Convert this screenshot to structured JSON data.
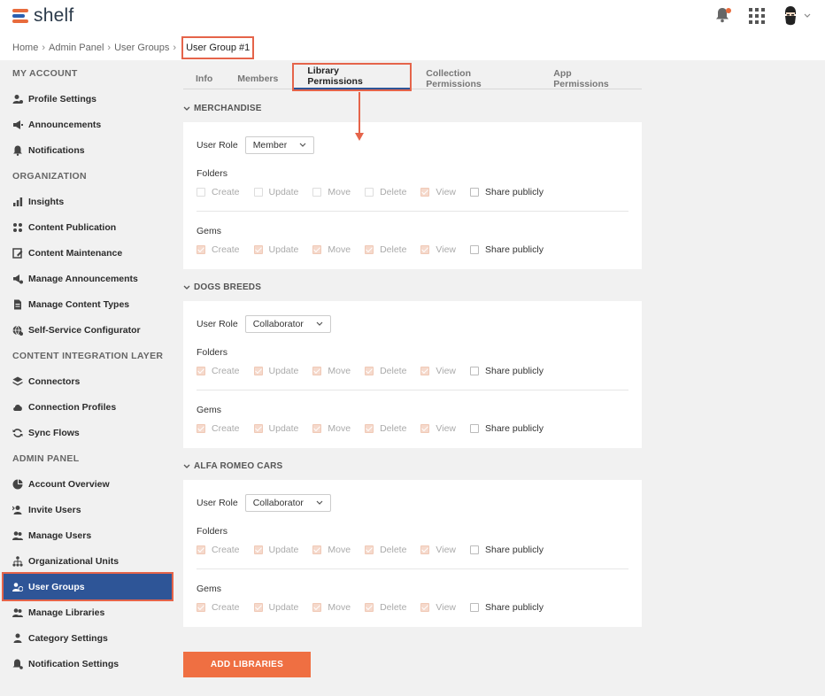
{
  "app": {
    "logo_text": "shelf"
  },
  "breadcrumb": {
    "items": [
      "Home",
      "Admin Panel",
      "User Groups"
    ],
    "current": "User Group #1"
  },
  "sidebar": {
    "sections": [
      {
        "title": "MY ACCOUNT",
        "items": [
          {
            "label": "Profile Settings",
            "icon": "user-gear-icon"
          },
          {
            "label": "Announcements",
            "icon": "megaphone-icon"
          },
          {
            "label": "Notifications",
            "icon": "bell-icon"
          }
        ]
      },
      {
        "title": "ORGANIZATION",
        "items": [
          {
            "label": "Insights",
            "icon": "bar-chart-icon"
          },
          {
            "label": "Content Publication",
            "icon": "dots-grid-icon"
          },
          {
            "label": "Content Maintenance",
            "icon": "edit-doc-icon"
          },
          {
            "label": "Manage Announcements",
            "icon": "megaphone-gear-icon"
          },
          {
            "label": "Manage Content Types",
            "icon": "document-icon"
          },
          {
            "label": "Self-Service Configurator",
            "icon": "globe-gear-icon"
          }
        ]
      },
      {
        "title": "CONTENT INTEGRATION LAYER",
        "items": [
          {
            "label": "Connectors",
            "icon": "layers-icon"
          },
          {
            "label": "Connection Profiles",
            "icon": "cloud-icon"
          },
          {
            "label": "Sync Flows",
            "icon": "sync-icon"
          }
        ]
      },
      {
        "title": "ADMIN PANEL",
        "items": [
          {
            "label": "Account Overview",
            "icon": "pie-chart-icon"
          },
          {
            "label": "Invite Users",
            "icon": "invite-user-icon"
          },
          {
            "label": "Manage Users",
            "icon": "users-icon"
          },
          {
            "label": "Organizational Units",
            "icon": "org-chart-icon"
          },
          {
            "label": "User Groups",
            "icon": "user-group-icon",
            "active": true
          },
          {
            "label": "Manage Libraries",
            "icon": "library-users-icon"
          },
          {
            "label": "Category Settings",
            "icon": "category-icon"
          },
          {
            "label": "Notification Settings",
            "icon": "bell-gear-icon"
          }
        ]
      }
    ]
  },
  "tabs": [
    "Info",
    "Members",
    "Library Permissions",
    "Collection Permissions",
    "App Permissions"
  ],
  "active_tab": "Library Permissions",
  "libraries": [
    {
      "name": "MERCHANDISE",
      "role_label": "User Role",
      "role": "Member",
      "folders_label": "Folders",
      "gems_label": "Gems",
      "folders": [
        {
          "label": "Create",
          "checked": false,
          "enabled": false
        },
        {
          "label": "Update",
          "checked": false,
          "enabled": false
        },
        {
          "label": "Move",
          "checked": false,
          "enabled": false
        },
        {
          "label": "Delete",
          "checked": false,
          "enabled": false
        },
        {
          "label": "View",
          "checked": true,
          "enabled": false
        },
        {
          "label": "Share publicly",
          "checked": false,
          "enabled": true
        }
      ],
      "gems": [
        {
          "label": "Create",
          "checked": true,
          "enabled": false
        },
        {
          "label": "Update",
          "checked": true,
          "enabled": false
        },
        {
          "label": "Move",
          "checked": true,
          "enabled": false
        },
        {
          "label": "Delete",
          "checked": true,
          "enabled": false
        },
        {
          "label": "View",
          "checked": true,
          "enabled": false
        },
        {
          "label": "Share publicly",
          "checked": false,
          "enabled": true
        }
      ]
    },
    {
      "name": "DOGS BREEDS",
      "role_label": "User Role",
      "role": "Collaborator",
      "folders_label": "Folders",
      "gems_label": "Gems",
      "folders": [
        {
          "label": "Create",
          "checked": true,
          "enabled": false
        },
        {
          "label": "Update",
          "checked": true,
          "enabled": false
        },
        {
          "label": "Move",
          "checked": true,
          "enabled": false
        },
        {
          "label": "Delete",
          "checked": true,
          "enabled": false
        },
        {
          "label": "View",
          "checked": true,
          "enabled": false
        },
        {
          "label": "Share publicly",
          "checked": false,
          "enabled": true
        }
      ],
      "gems": [
        {
          "label": "Create",
          "checked": true,
          "enabled": false
        },
        {
          "label": "Update",
          "checked": true,
          "enabled": false
        },
        {
          "label": "Move",
          "checked": true,
          "enabled": false
        },
        {
          "label": "Delete",
          "checked": true,
          "enabled": false
        },
        {
          "label": "View",
          "checked": true,
          "enabled": false
        },
        {
          "label": "Share publicly",
          "checked": false,
          "enabled": true
        }
      ]
    },
    {
      "name": "ALFA ROMEO CARS",
      "role_label": "User Role",
      "role": "Collaborator",
      "folders_label": "Folders",
      "gems_label": "Gems",
      "folders": [
        {
          "label": "Create",
          "checked": true,
          "enabled": false
        },
        {
          "label": "Update",
          "checked": true,
          "enabled": false
        },
        {
          "label": "Move",
          "checked": true,
          "enabled": false
        },
        {
          "label": "Delete",
          "checked": true,
          "enabled": false
        },
        {
          "label": "View",
          "checked": true,
          "enabled": false
        },
        {
          "label": "Share publicly",
          "checked": false,
          "enabled": true
        }
      ],
      "gems": [
        {
          "label": "Create",
          "checked": true,
          "enabled": false
        },
        {
          "label": "Update",
          "checked": true,
          "enabled": false
        },
        {
          "label": "Move",
          "checked": true,
          "enabled": false
        },
        {
          "label": "Delete",
          "checked": true,
          "enabled": false
        },
        {
          "label": "View",
          "checked": true,
          "enabled": false
        },
        {
          "label": "Share publicly",
          "checked": false,
          "enabled": true
        }
      ]
    }
  ],
  "add_button_label": "ADD LIBRARIES",
  "colors": {
    "accent": "#ef6f42",
    "primary": "#2e5597",
    "highlight": "#e5644a"
  }
}
